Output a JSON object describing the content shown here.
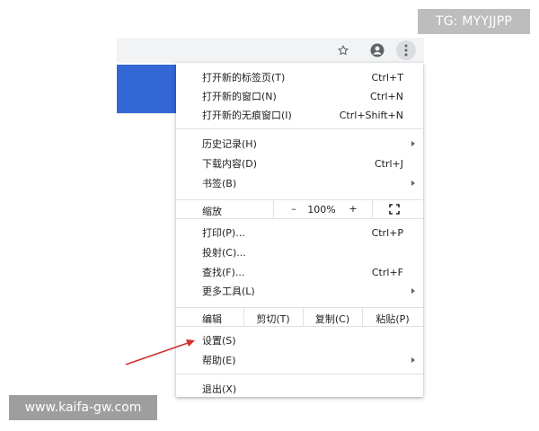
{
  "watermark": {
    "top_right": "TG: MYYJJPP",
    "bottom_left": "www.kaifa-gw.com"
  },
  "toolbar": {
    "icons": [
      "star-icon",
      "account-icon",
      "kebab-menu-icon"
    ],
    "accent_color": "#3367d6"
  },
  "menu": {
    "items": [
      {
        "label": "打开新的标签页(T)",
        "shortcut": "Ctrl+T"
      },
      {
        "label": "打开新的窗口(N)",
        "shortcut": "Ctrl+N"
      },
      {
        "label": "打开新的无痕窗口(I)",
        "shortcut": "Ctrl+Shift+N"
      },
      {
        "label": "历史记录(H)",
        "shortcut": ""
      },
      {
        "label": "下载内容(D)",
        "shortcut": "Ctrl+J"
      },
      {
        "label": "书签(B)",
        "shortcut": ""
      },
      {
        "label": "打印(P)...",
        "shortcut": "Ctrl+P"
      },
      {
        "label": "投射(C)...",
        "shortcut": ""
      },
      {
        "label": "查找(F)...",
        "shortcut": "Ctrl+F"
      },
      {
        "label": "更多工具(L)",
        "shortcut": ""
      },
      {
        "label": "设置(S)",
        "shortcut": ""
      },
      {
        "label": "帮助(E)",
        "shortcut": ""
      },
      {
        "label": "退出(X)",
        "shortcut": ""
      }
    ],
    "zoom": {
      "label": "缩放",
      "minus": "–",
      "value": "100%",
      "plus": "+"
    },
    "edit": {
      "label": "编辑",
      "cut": "剪切(T)",
      "copy": "复制(C)",
      "paste": "粘贴(P)"
    }
  },
  "annotation": {
    "color": "#d32f2f",
    "points_to": "设置(S)"
  }
}
